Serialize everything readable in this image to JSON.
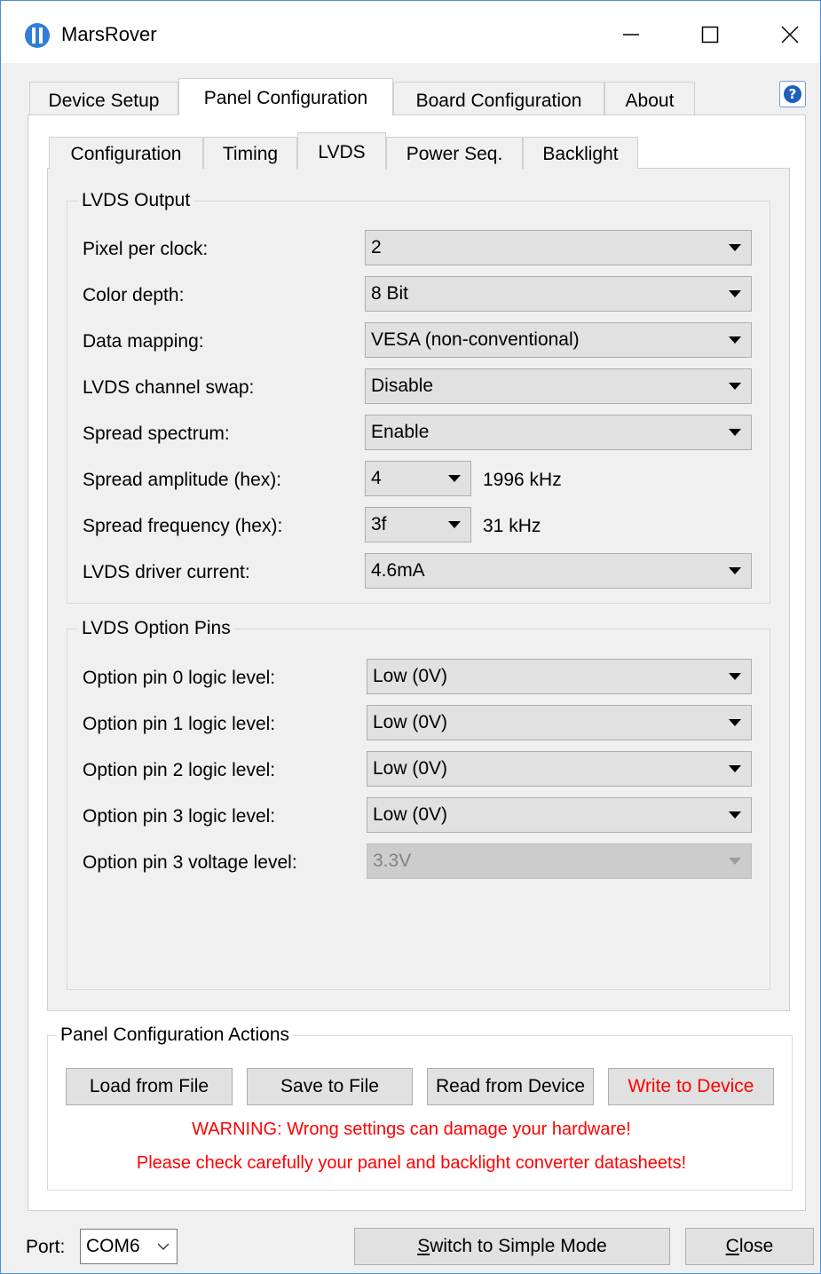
{
  "window": {
    "title": "MarsRover",
    "accent": "#4a8fd6"
  },
  "tabs": [
    {
      "label": "Device Setup"
    },
    {
      "label": "Panel Configuration",
      "active": true
    },
    {
      "label": "Board Configuration"
    },
    {
      "label": "About"
    }
  ],
  "subtabs": [
    {
      "label": "Configuration"
    },
    {
      "label": "Timing"
    },
    {
      "label": "LVDS",
      "active": true
    },
    {
      "label": "Power Seq."
    },
    {
      "label": "Backlight"
    }
  ],
  "lvds_output": {
    "title": "LVDS Output",
    "rows": [
      {
        "label": "Pixel per clock:",
        "value": "2"
      },
      {
        "label": "Color depth:",
        "value": "8 Bit"
      },
      {
        "label": "Data mapping:",
        "value": "VESA (non-conventional)"
      },
      {
        "label": "LVDS channel swap:",
        "value": "Disable"
      },
      {
        "label": "Spread spectrum:",
        "value": "Enable"
      },
      {
        "label": "Spread amplitude (hex):",
        "value": "4",
        "suffix": "1996 kHz"
      },
      {
        "label": "Spread frequency (hex):",
        "value": "3f",
        "suffix": "31 kHz"
      },
      {
        "label": "LVDS driver current:",
        "value": "4.6mA"
      }
    ]
  },
  "lvds_option_pins": {
    "title": "LVDS Option Pins",
    "rows": [
      {
        "label": "Option pin 0 logic level:",
        "value": "Low (0V)"
      },
      {
        "label": "Option pin 1 logic level:",
        "value": "Low (0V)"
      },
      {
        "label": "Option pin 2 logic level:",
        "value": "Low (0V)"
      },
      {
        "label": "Option pin 3 logic level:",
        "value": "Low (0V)"
      },
      {
        "label": "Option pin 3 voltage level:",
        "value": "3.3V",
        "disabled": true
      }
    ]
  },
  "actions": {
    "title": "Panel Configuration Actions",
    "load": "Load from File",
    "save": "Save to File",
    "read": "Read from Device",
    "write": "Write to Device",
    "warning1": "WARNING: Wrong settings can damage your hardware!",
    "warning2": "Please check carefully your panel and backlight converter datasheets!",
    "warning_color": "#ff0000"
  },
  "footer": {
    "port_label": "Port:",
    "port_value": "COM6",
    "switch_mnemonic": "S",
    "switch_rest": "witch to Simple Mode",
    "close_mnemonic": "C",
    "close_rest": "lose"
  },
  "icons": [
    "app-icon",
    "minimize-icon",
    "maximize-icon",
    "close-icon",
    "help-icon",
    "dropdown-arrow-icon",
    "chevron-down-icon"
  ]
}
